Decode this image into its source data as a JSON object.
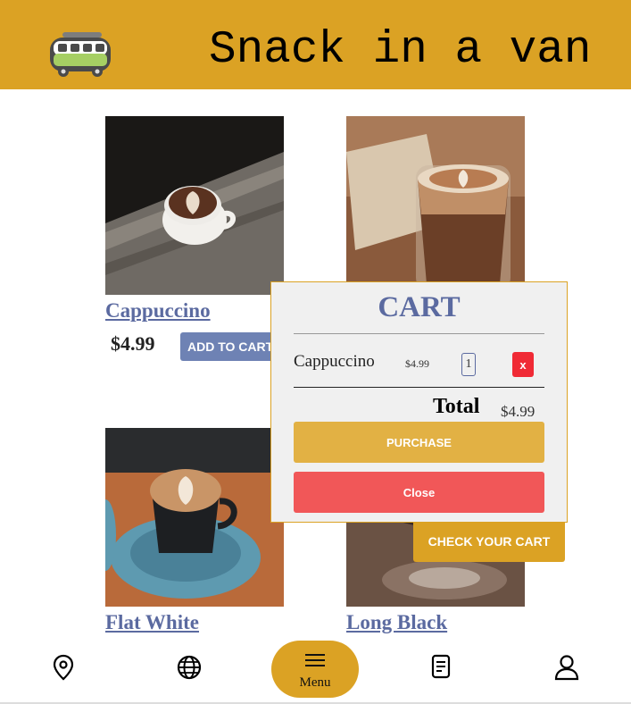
{
  "header": {
    "brand": "Snack in a van",
    "logo_icon": "van-icon",
    "bg_color": "#dba224"
  },
  "products": [
    {
      "name": "Cappuccino",
      "price": "$4.99",
      "add_label": "ADD TO CART"
    },
    {
      "name": "Flat White"
    },
    {
      "name": "Long Black"
    }
  ],
  "check_cart_label": "CHECK YOUR CART",
  "cart": {
    "title": "CART",
    "items": [
      {
        "name": "Cappuccino",
        "price": "$4.99",
        "qty": "1",
        "remove_label": "x"
      }
    ],
    "total_label": "Total",
    "total_value": "$4.99",
    "purchase_label": "PURCHASE",
    "close_label": "Close"
  },
  "nav": {
    "items": [
      "location-icon",
      "globe-icon",
      "menu-icon",
      "receipt-icon",
      "user-icon"
    ],
    "menu_label": "Menu"
  },
  "colors": {
    "accent": "#dba224",
    "link": "#5b6aa0",
    "danger": "#f15758",
    "add_button": "#6e82b4"
  }
}
